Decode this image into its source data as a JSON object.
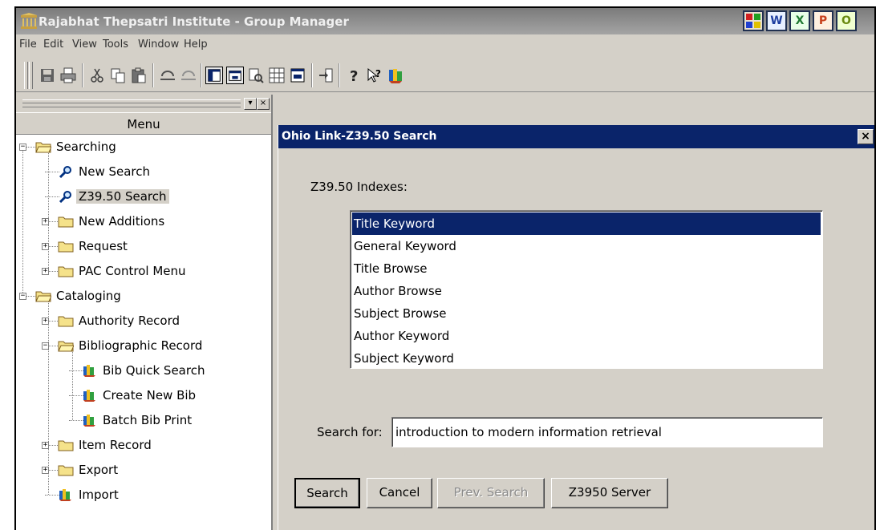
{
  "window": {
    "title": "Rajabhat Thepsatri Institute - Group Manager"
  },
  "office_icons": [
    {
      "name": "access-icon",
      "letter": "",
      "color": "#c04000"
    },
    {
      "name": "word-icon",
      "letter": "W",
      "color": "#1f3fa0"
    },
    {
      "name": "excel-icon",
      "letter": "X",
      "color": "#1e7a32"
    },
    {
      "name": "powerpoint-icon",
      "letter": "P",
      "color": "#c8401c"
    },
    {
      "name": "outlook-icon",
      "letter": "O",
      "color": "#6a8a10"
    }
  ],
  "menubar": [
    "File",
    "Edit",
    "View",
    "Tools",
    "Window",
    "Help"
  ],
  "left_panel": {
    "menu_title": "Menu",
    "tree": [
      {
        "label": "Searching",
        "level": 0,
        "icon": "folder-open",
        "expander": "minus"
      },
      {
        "label": "New Search",
        "level": 1,
        "icon": "search"
      },
      {
        "label": "Z39.50 Search",
        "level": 1,
        "icon": "search",
        "selected": true
      },
      {
        "label": "New Additions",
        "level": 1,
        "icon": "folder",
        "expander": "plus"
      },
      {
        "label": "Request",
        "level": 1,
        "icon": "folder",
        "expander": "plus"
      },
      {
        "label": "PAC Control Menu",
        "level": 1,
        "icon": "folder",
        "expander": "plus"
      },
      {
        "label": "Cataloging",
        "level": 0,
        "icon": "folder-open",
        "expander": "minus"
      },
      {
        "label": "Authority Record",
        "level": 1,
        "icon": "folder",
        "expander": "plus"
      },
      {
        "label": "Bibliographic Record",
        "level": 1,
        "icon": "folder-open",
        "expander": "minus"
      },
      {
        "label": "Bib Quick Search",
        "level": 2,
        "icon": "books"
      },
      {
        "label": "Create New Bib",
        "level": 2,
        "icon": "books"
      },
      {
        "label": "Batch Bib Print",
        "level": 2,
        "icon": "books"
      },
      {
        "label": "Item Record",
        "level": 1,
        "icon": "folder",
        "expander": "plus"
      },
      {
        "label": "Export",
        "level": 1,
        "icon": "folder",
        "expander": "plus"
      },
      {
        "label": "Import",
        "level": 1,
        "icon": "books"
      }
    ]
  },
  "dialog": {
    "title": "Ohio Link-Z39.50 Search",
    "close_label": "x",
    "indexes_label": "Z39.50 Indexes:",
    "indexes": [
      "Title Keyword",
      "General Keyword",
      "Title Browse",
      "Author Browse",
      "Subject Browse",
      "Author Keyword",
      "Subject Keyword"
    ],
    "selected_index": "Title Keyword",
    "search_for_label": "Search for:",
    "search_value": "introduction to modern information retrieval",
    "buttons": {
      "search": "Search",
      "cancel": "Cancel",
      "prev_search": "Prev. Search",
      "server": "Z3950 Server"
    }
  },
  "colors": {
    "titlebar_active": "#0a246a",
    "face": "#d4d0c8",
    "selection": "#0a246a"
  }
}
